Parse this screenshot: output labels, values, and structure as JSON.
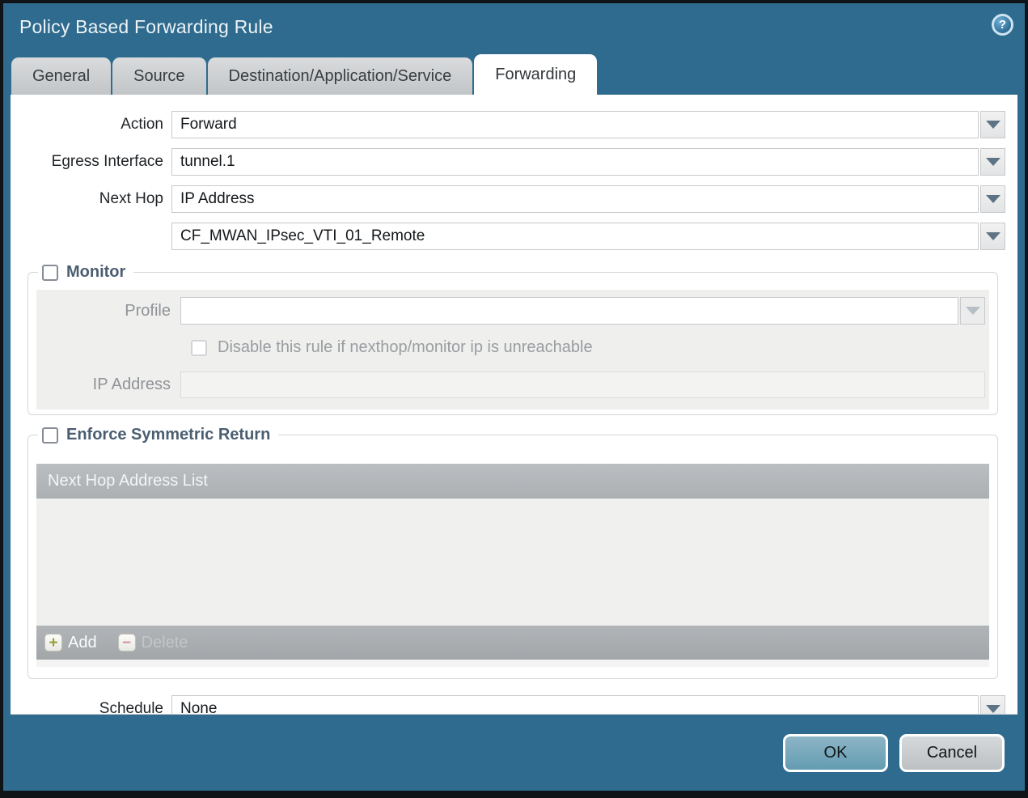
{
  "window": {
    "title": "Policy Based Forwarding Rule",
    "help_icon": "?"
  },
  "tabs": [
    {
      "label": "General",
      "active": false
    },
    {
      "label": "Source",
      "active": false
    },
    {
      "label": "Destination/Application/Service",
      "active": false
    },
    {
      "label": "Forwarding",
      "active": true
    }
  ],
  "form": {
    "action": {
      "label": "Action",
      "value": "Forward"
    },
    "egress_interface": {
      "label": "Egress Interface",
      "value": "tunnel.1"
    },
    "next_hop": {
      "label": "Next Hop",
      "value": "IP Address"
    },
    "next_hop_address": {
      "value": "CF_MWAN_IPsec_VTI_01_Remote"
    },
    "schedule": {
      "label": "Schedule",
      "value": "None"
    }
  },
  "monitor": {
    "title": "Monitor",
    "checked": false,
    "profile": {
      "label": "Profile",
      "value": ""
    },
    "disable_rule": {
      "label": "Disable this rule if nexthop/monitor ip is unreachable",
      "checked": false
    },
    "ip_address": {
      "label": "IP Address",
      "value": ""
    }
  },
  "symmetric_return": {
    "title": "Enforce Symmetric Return",
    "checked": false,
    "table": {
      "header": "Next Hop Address List",
      "rows": [],
      "add_label": "Add",
      "delete_label": "Delete"
    }
  },
  "footer": {
    "ok_label": "OK",
    "cancel_label": "Cancel"
  },
  "colors": {
    "frame_teal": "#2e6b8e",
    "ok_button": "#6ea2b8",
    "cancel_button": "#c6c9cc",
    "beige_disabled_field": "#f2ecdc",
    "section_title": "#4b5e71",
    "table_header_gray": "#b3b7ba",
    "tab_gray": "#c8cbcd"
  }
}
